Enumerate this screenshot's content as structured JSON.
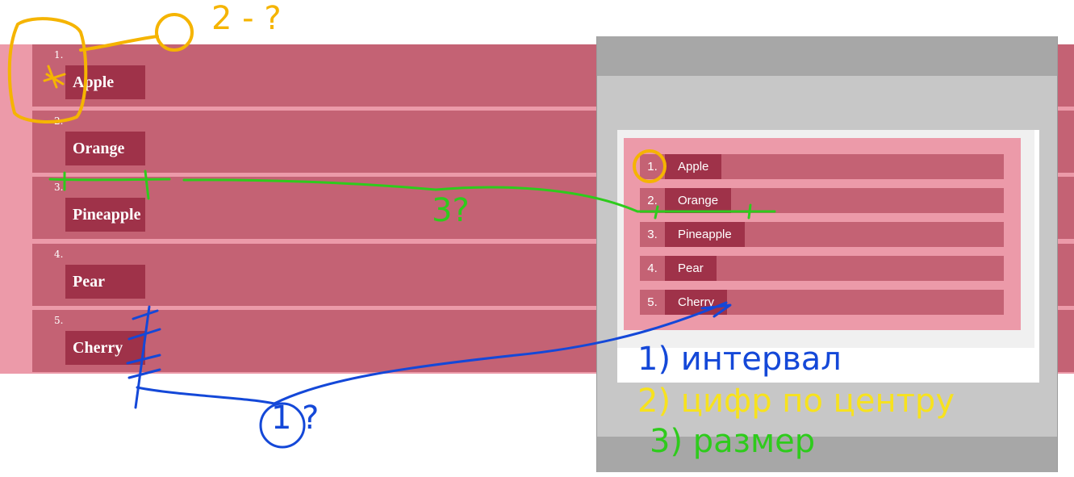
{
  "list": {
    "items": [
      {
        "number": "1.",
        "label": "Apple"
      },
      {
        "number": "2.",
        "label": "Orange"
      },
      {
        "number": "3.",
        "label": "Pineapple"
      },
      {
        "number": "4.",
        "label": "Pear"
      },
      {
        "number": "5.",
        "label": "Cherry"
      }
    ]
  },
  "preview": {
    "items": [
      {
        "number": "1.",
        "label": "Apple"
      },
      {
        "number": "2.",
        "label": "Orange"
      },
      {
        "number": "3.",
        "label": "Pineapple"
      },
      {
        "number": "4.",
        "label": "Pear"
      },
      {
        "number": "5.",
        "label": "Cherry"
      }
    ]
  },
  "annotations": {
    "colors": {
      "orange": "#f5b400",
      "green": "#2ecb1c",
      "blue": "#1448d8",
      "yellow": "#f7e21e"
    },
    "top_mark": "2 - ?",
    "green_mark": "3?",
    "blue_mark": "1 ?",
    "notes": [
      {
        "text": "1) интервал"
      },
      {
        "text": "2) цифр по центру"
      },
      {
        "text": "3) размер"
      }
    ]
  }
}
